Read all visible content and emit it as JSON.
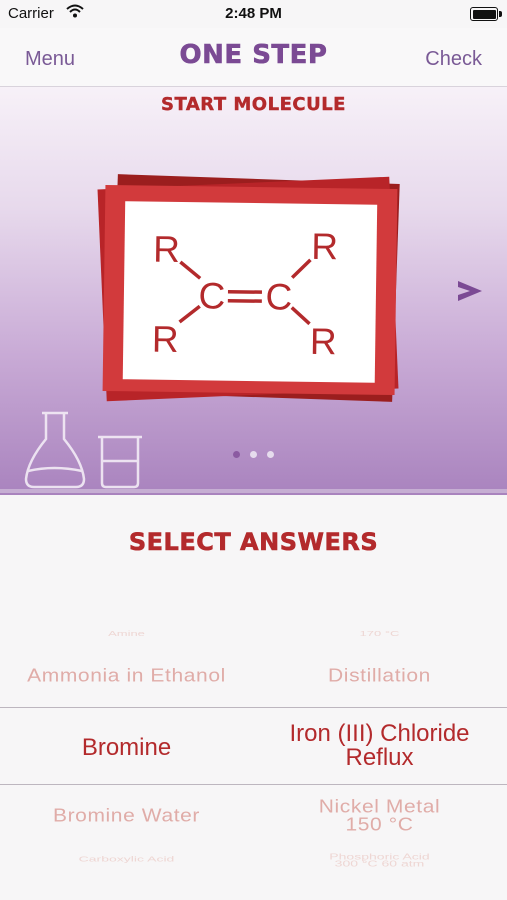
{
  "status_bar": {
    "carrier": "Carrier",
    "time": "2:48 PM"
  },
  "nav": {
    "left_label": "Menu",
    "title": "ONE STEP",
    "right_label": "Check"
  },
  "hero": {
    "label": "START MOLECULE",
    "molecule": {
      "substituent": "R",
      "carbon": "C",
      "bond": "═"
    },
    "page_count": 3,
    "active_page": 1
  },
  "section": {
    "title": "SELECT ANSWERS"
  },
  "picker": {
    "reagents": [
      "Amine",
      "Ammonia in Ethanol",
      "Bromine",
      "Bromine Water",
      "Carboxylic Acid"
    ],
    "conditions": [
      {
        "line1": "170 °C",
        "line2": ""
      },
      {
        "line1": "Distillation",
        "line2": ""
      },
      {
        "line1": "Iron (III) Chloride",
        "line2": "Reflux"
      },
      {
        "line1": "Nickel Metal",
        "line2": "150 °C"
      },
      {
        "line1": "Phosphoric Acid",
        "line2": "300 °C 60 atm"
      }
    ],
    "selected_reagent": "Bromine",
    "selected_condition": "Iron (III) Chloride Reflux"
  },
  "colors": {
    "purple": "#7b4a94",
    "red": "#b32a2c",
    "faded_red": "#e2b1ad"
  }
}
